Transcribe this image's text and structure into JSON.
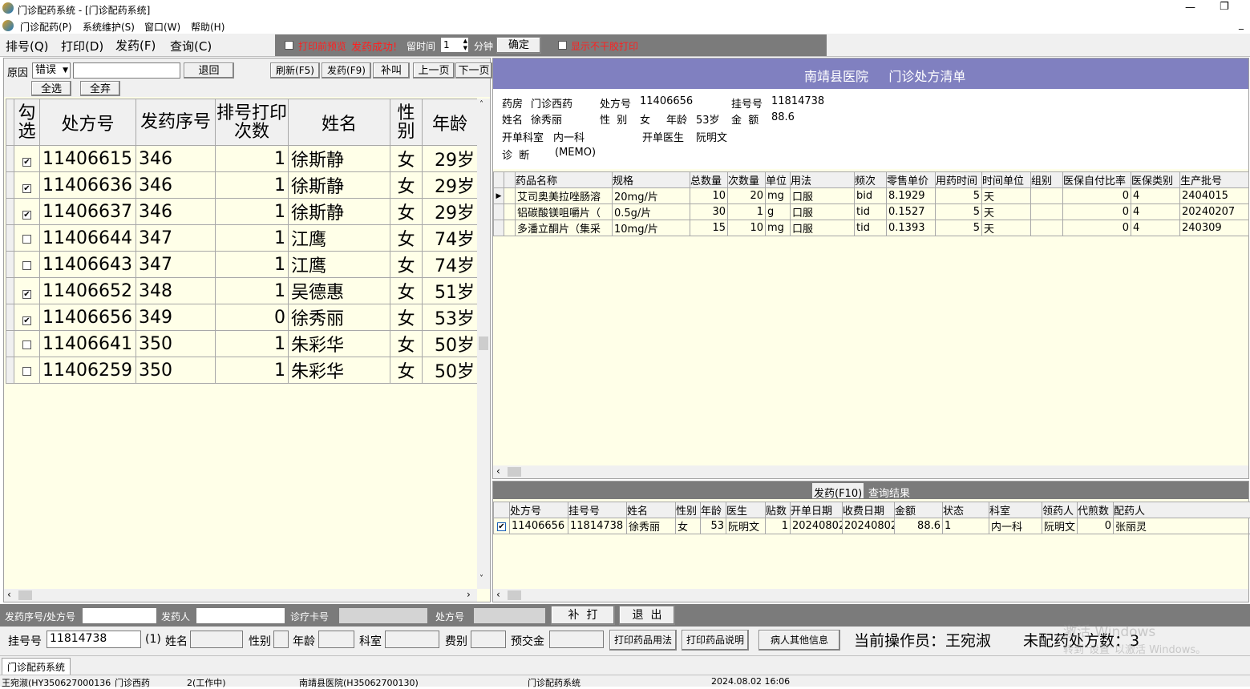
{
  "window": {
    "title": "门诊配药系统 - [门诊配药系统]"
  },
  "menubar": {
    "items": [
      "门诊配药(P)",
      "系统维护(S)",
      "窗口(W)",
      "帮助(H)"
    ]
  },
  "toolbar": {
    "tabs": [
      "排号(Q)",
      "打印(D)",
      "发药(F)",
      "查询(C)"
    ],
    "print_preview_label": "打印前预览",
    "status_message": "发药成功!",
    "stay_label": "留时间",
    "stay_value": "1",
    "minutes_label": "分钟",
    "confirm_button": "确定",
    "no_dry_print_label": "显示不干胶打印"
  },
  "left_panel": {
    "reason_label": "原因",
    "reason_value": "错误",
    "reason_text": "",
    "return_button": "退回",
    "refresh_button": "刷新(F5)",
    "dispense_button": "发药(F9)",
    "call_button": "补叫",
    "prev_button": "上一页",
    "next_button": "下一页",
    "select_all_button": "全选",
    "deselect_all_button": "全弃",
    "columns": [
      "勾选",
      "处方号",
      "发药序号",
      "排号打印次数",
      "姓名",
      "性别",
      "年龄"
    ],
    "rows": [
      {
        "checked": true,
        "rx": "11406615",
        "seq": "346",
        "prints": "1",
        "name": "徐斯静",
        "sex": "女",
        "age": "29岁"
      },
      {
        "checked": true,
        "rx": "11406636",
        "seq": "346",
        "prints": "1",
        "name": "徐斯静",
        "sex": "女",
        "age": "29岁"
      },
      {
        "checked": true,
        "rx": "11406637",
        "seq": "346",
        "prints": "1",
        "name": "徐斯静",
        "sex": "女",
        "age": "29岁"
      },
      {
        "checked": false,
        "rx": "11406644",
        "seq": "347",
        "prints": "1",
        "name": "江鹰",
        "sex": "女",
        "age": "74岁"
      },
      {
        "checked": false,
        "rx": "11406643",
        "seq": "347",
        "prints": "1",
        "name": "江鹰",
        "sex": "女",
        "age": "74岁"
      },
      {
        "checked": true,
        "rx": "11406652",
        "seq": "348",
        "prints": "1",
        "name": "吴德惠",
        "sex": "女",
        "age": "51岁"
      },
      {
        "checked": true,
        "rx": "11406656",
        "seq": "349",
        "prints": "0",
        "name": "徐秀丽",
        "sex": "女",
        "age": "53岁"
      },
      {
        "checked": false,
        "rx": "11406641",
        "seq": "350",
        "prints": "1",
        "name": "朱彩华",
        "sex": "女",
        "age": "50岁"
      },
      {
        "checked": false,
        "rx": "11406259",
        "seq": "350",
        "prints": "1",
        "name": "朱彩华",
        "sex": "女",
        "age": "50岁"
      }
    ]
  },
  "prescription": {
    "header": "南靖县医院     门诊处方清单",
    "pharmacy_label": "药房",
    "pharmacy": "门诊西药",
    "rx_label": "处方号",
    "rx": "11406656",
    "reg_label": "挂号号",
    "reg": "11814738",
    "name_label": "姓名",
    "name": "徐秀丽",
    "sex_label": "性  别",
    "sex": "女",
    "age_label": "年龄",
    "age": "53岁",
    "amount_label": "金  额",
    "amount": "88.6",
    "dept_label": "开单科室",
    "dept": "内一科",
    "doctor_label": "开单医生",
    "doctor": "阮明文",
    "diag_label": "诊  断",
    "diag": "(MEMO)",
    "columns": [
      "药品名称",
      "规格",
      "总数量",
      "次数量",
      "单位",
      "用法",
      "频次",
      "零售单价",
      "用药时间",
      "时间单位",
      "组别",
      "医保自付比率",
      "医保类别",
      "生产批号"
    ],
    "drugs": [
      {
        "name": "艾司奥美拉唑肠溶",
        "spec": "20mg/片",
        "total": "10",
        "per": "20",
        "unit": "mg",
        "usage": "口服",
        "freq": "bid",
        "price": "8.1929",
        "days": "5",
        "tunit": "天",
        "group": "",
        "ratio": "0",
        "cat": "4",
        "batch": "2404015"
      },
      {
        "name": "铝碳酸镁咀嚼片（",
        "spec": "0.5g/片",
        "total": "30",
        "per": "1",
        "unit": "g",
        "usage": "口服",
        "freq": "tid",
        "price": "0.1527",
        "days": "5",
        "tunit": "天",
        "group": "",
        "ratio": "0",
        "cat": "4",
        "batch": "20240207"
      },
      {
        "name": "多潘立酮片（集采",
        "spec": "10mg/片",
        "total": "15",
        "per": "10",
        "unit": "mg",
        "usage": "口服",
        "freq": "tid",
        "price": "0.1393",
        "days": "5",
        "tunit": "天",
        "group": "",
        "ratio": "0",
        "cat": "4",
        "batch": "240309"
      }
    ]
  },
  "result": {
    "tab_dispense": "发药(F10)",
    "tab_query": "查询结果",
    "columns": [
      "处方号",
      "挂号号",
      "姓名",
      "性别",
      "年龄",
      "医生",
      "贴数",
      "开单日期",
      "收费日期",
      "金额",
      "状态",
      "科室",
      "领药人",
      "代煎数",
      "配药人"
    ],
    "rows": [
      {
        "checked": true,
        "rx": "11406656",
        "reg": "11814738",
        "name": "徐秀丽",
        "sex": "女",
        "age": "53",
        "doctor": "阮明文",
        "tie": "1",
        "open_date": "20240802",
        "pay_date": "20240802",
        "amount": "88.6",
        "status": "1",
        "dept": "内一科",
        "receiver": "阮明文",
        "decoct": "0",
        "dispenser": "张丽灵"
      }
    ]
  },
  "bottom_bar1": {
    "seq_label": "发药序号/处方号",
    "dispenser_label": "发药人",
    "card_label": "诊疗卡号",
    "rx_label": "处方号",
    "reprint_button": "补  打",
    "exit_button": "退  出"
  },
  "bottom_bar2": {
    "reg_label": "挂号号",
    "reg_value": "11814738",
    "count_label": "(1)",
    "name_label": "姓名",
    "sex_label": "性别",
    "age_label": "年龄",
    "dept_label": "科室",
    "fee_label": "费别",
    "deposit_label": "预交金",
    "print_usage_button": "打印药品用法",
    "print_desc_button": "打印药品说明",
    "other_info_button": "病人其他信息",
    "operator_label": "当前操作员：王宛淑",
    "pending_label": "未配药处方数：3",
    "watermark1": "激活 Windows",
    "watermark2": "转到\"设置\"以激活 Windows。"
  },
  "taskbar": {
    "tab": "门诊配药系统"
  },
  "statusbar": {
    "user": "王宛淑(HY350627000136)",
    "pharmacy": "门诊西药",
    "mode": "2(工作中)",
    "hospital": "南靖县医院(H35062700130)",
    "system": "门诊配药系统",
    "datetime": "2024.08.02 16:06"
  }
}
